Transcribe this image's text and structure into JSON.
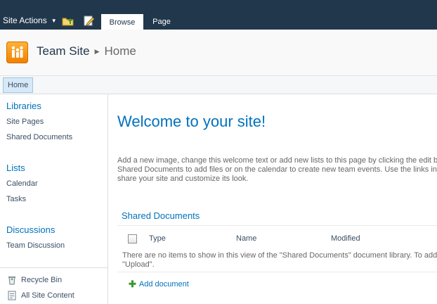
{
  "ribbon": {
    "site_actions_label": "Site Actions",
    "icons": [
      "navigate-up-icon",
      "edit-page-icon"
    ],
    "tabs": [
      {
        "label": "Browse",
        "active": true
      },
      {
        "label": "Page",
        "active": false
      }
    ],
    "bg_color": "#21374c"
  },
  "title_area": {
    "site_title": "Team Site",
    "page_title": "Home"
  },
  "top_nav": {
    "items": [
      {
        "label": "Home",
        "selected": true
      }
    ]
  },
  "quick_launch": {
    "sections": [
      {
        "heading": "Libraries",
        "items": [
          "Site Pages",
          "Shared Documents"
        ]
      },
      {
        "heading": "Lists",
        "items": [
          "Calendar",
          "Tasks"
        ]
      },
      {
        "heading": "Discussions",
        "items": [
          "Team Discussion"
        ]
      }
    ],
    "bottom_links": [
      {
        "label": "Recycle Bin",
        "icon": "recycle-bin-icon"
      },
      {
        "label": "All Site Content",
        "icon": "site-content-icon"
      }
    ]
  },
  "main": {
    "welcome_heading": "Welcome to your site!",
    "description_lines": [
      "Add a new image, change this welcome text or add new lists to this page by clicking the edit button above. You can click on",
      "Shared Documents to add files or on the calendar to create new team events. Use the links in the getting started section to",
      "share your site and customize its look."
    ],
    "web_part": {
      "title": "Shared Documents",
      "columns": [
        "Type",
        "Name",
        "Modified"
      ],
      "empty_lines": [
        "There are no items to show in this view of the \"Shared Documents\" document library. To add a new item, click \"New\" or",
        "\"Upload\"."
      ],
      "add_label": "Add document"
    }
  },
  "colors": {
    "link": "#0072bc",
    "text": "#3b4f65",
    "muted": "#676767",
    "logo_orange": "#f07f00"
  }
}
